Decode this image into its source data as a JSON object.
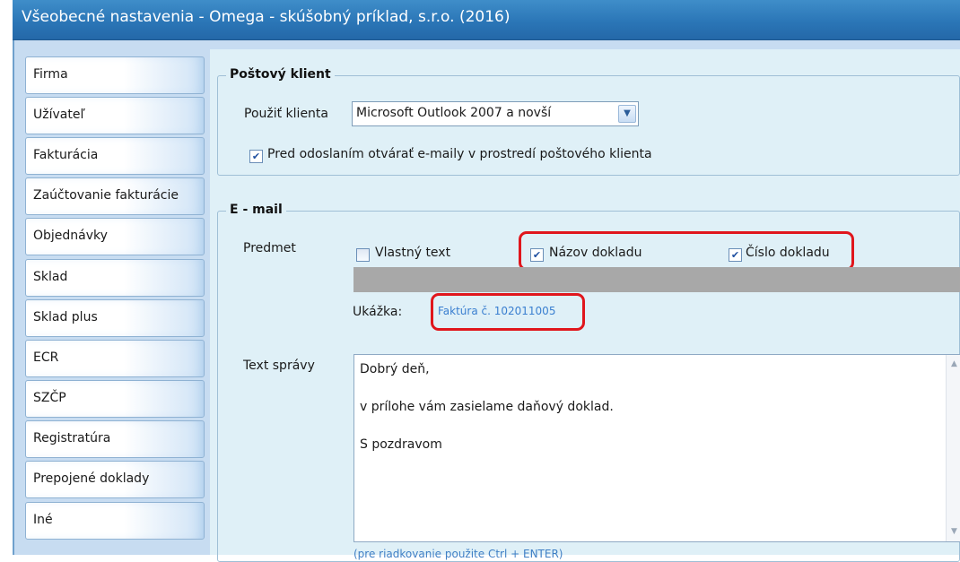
{
  "window": {
    "title": "Všeobecné nastavenia - Omega - skúšobný príklad, s.r.o. (2016)"
  },
  "sidebar": {
    "items": [
      {
        "label": "Firma"
      },
      {
        "label": "Užívateľ"
      },
      {
        "label": "Fakturácia"
      },
      {
        "label": "Zaúčtovanie fakturácie"
      },
      {
        "label": "Objednávky"
      },
      {
        "label": "Sklad"
      },
      {
        "label": "Sklad plus"
      },
      {
        "label": "ECR"
      },
      {
        "label": "SZČP"
      },
      {
        "label": "Registratúra"
      },
      {
        "label": "Prepojené doklady"
      },
      {
        "label": "Iné"
      }
    ]
  },
  "mail_client": {
    "group_label": "Poštový klient",
    "use_client_label": "Použiť klienta",
    "client_value": "Microsoft Outlook 2007 a novší",
    "open_in_client_label": "Pred odoslaním otvárať e-maily v prostredí poštového klienta",
    "open_in_client_checked": true
  },
  "email": {
    "group_label": "E - mail",
    "subject_label": "Predmet",
    "custom_text_label": "Vlastný text",
    "custom_text_checked": false,
    "doc_name_label": "Názov dokladu",
    "doc_name_checked": true,
    "doc_number_label": "Číslo dokladu",
    "doc_number_checked": true,
    "preview_label": "Ukážka:",
    "preview_value": "Faktúra č. 102011005",
    "message_label": "Text správy",
    "message_lines": [
      "Dobrý deň,",
      "v prílohe vám zasielame daňový doklad.",
      "S pozdravom"
    ],
    "hint": "(pre riadkovanie použite Ctrl + ENTER)"
  },
  "colors": {
    "titlebar": "#2b76b7",
    "highlight": "#e0161c",
    "panel": "#dff0f7"
  }
}
